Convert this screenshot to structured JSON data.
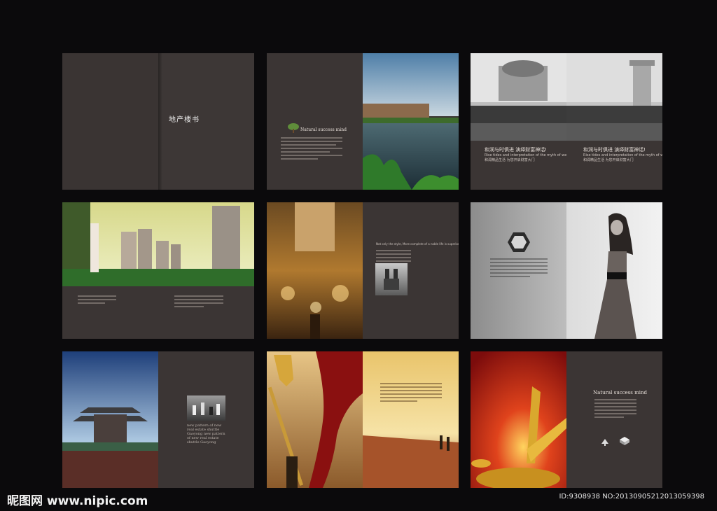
{
  "spreads": {
    "s1": {
      "title": "地产楼书"
    },
    "s2": {
      "heading": "Natural success mind"
    },
    "s3": {
      "caption_left": "和润与时俱进 演绎财富神话!",
      "caption_right": "和润与时俱进 演绎财富神话!",
      "sub_left": "Rise tides and interpretation of the myth of wealth",
      "sub_right": "Rise tides and interpretation of the myth of wealth",
      "line_left": "和润精品生活 为您开启财富大门",
      "line_right": "和润精品生活 为您开启财富大门"
    },
    "s5": {
      "heading": "Not only the style, More complete of a noble life is superior."
    },
    "s7": {
      "text": "new pattern of new real estate shuttle Gaoyong new pattern of new real estate shuttle Gaoyong"
    },
    "s9": {
      "heading": "Natural success mind"
    }
  },
  "footer": {
    "watermark": "昵图网 www.nipic.com",
    "id_text": "ID:9308938 NO:20130905212013059398"
  },
  "colors": {
    "background": "#0b0a0c",
    "page": "#3b3534"
  }
}
